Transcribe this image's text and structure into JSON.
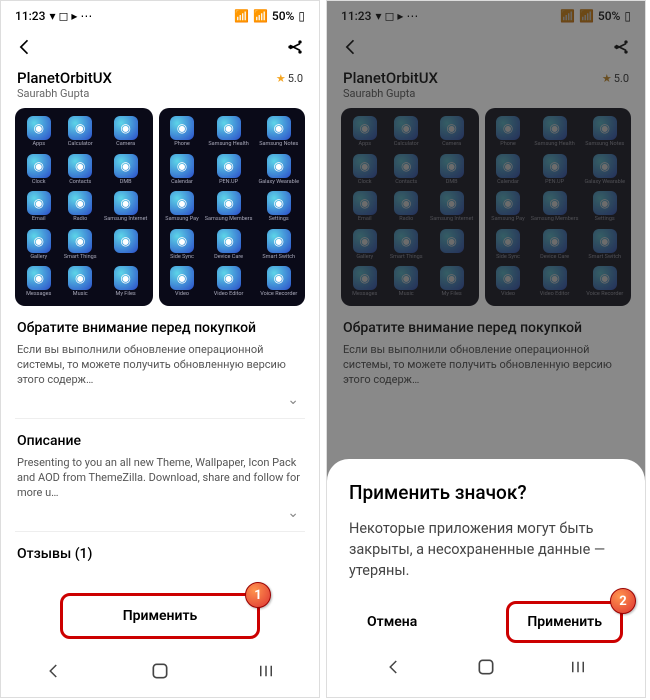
{
  "status": {
    "time": "11:23",
    "battery": "50%"
  },
  "app": {
    "title": "PlanetOrbitUX",
    "author": "Saurabh Gupta",
    "rating": "5.0"
  },
  "icons": {
    "left": [
      "Apps",
      "Calculator",
      "Camera",
      "Clock",
      "Contacts",
      "DMB",
      "Email",
      "Radio",
      "Samsung Internet",
      "Gallery",
      "Smart Things",
      "",
      "Messages",
      "Music",
      "My Files"
    ],
    "right": [
      "Phone",
      "Samsung Health",
      "Samsung Notes",
      "Calendar",
      "PEN.UP",
      "Galaxy Wearable",
      "Samsung Pay",
      "Samsung Members",
      "Settings",
      "Side Sync",
      "Device Care",
      "Smart Switch",
      "Video",
      "Video Editor",
      "Voice Recorder"
    ]
  },
  "sections": {
    "notice_title": "Обратите внимание перед покупкой",
    "notice_text": "Если вы выполнили обновление операционной системы, то можете получить обновленную версию этого содерж…",
    "desc_title": "Описание",
    "desc_text": "Presenting to you an all new Theme, Wallpaper, Icon Pack and AOD from ThemeZilla. Download, share and follow for more u…",
    "reviews_title": "Отзывы (1)"
  },
  "buttons": {
    "apply": "Применить"
  },
  "dialog": {
    "title": "Применить значок?",
    "body": "Некоторые приложения могут быть закрыты, а несохраненные данные — утеряны.",
    "cancel": "Отмена",
    "confirm": "Применить"
  },
  "badges": {
    "b1": "1",
    "b2": "2"
  }
}
